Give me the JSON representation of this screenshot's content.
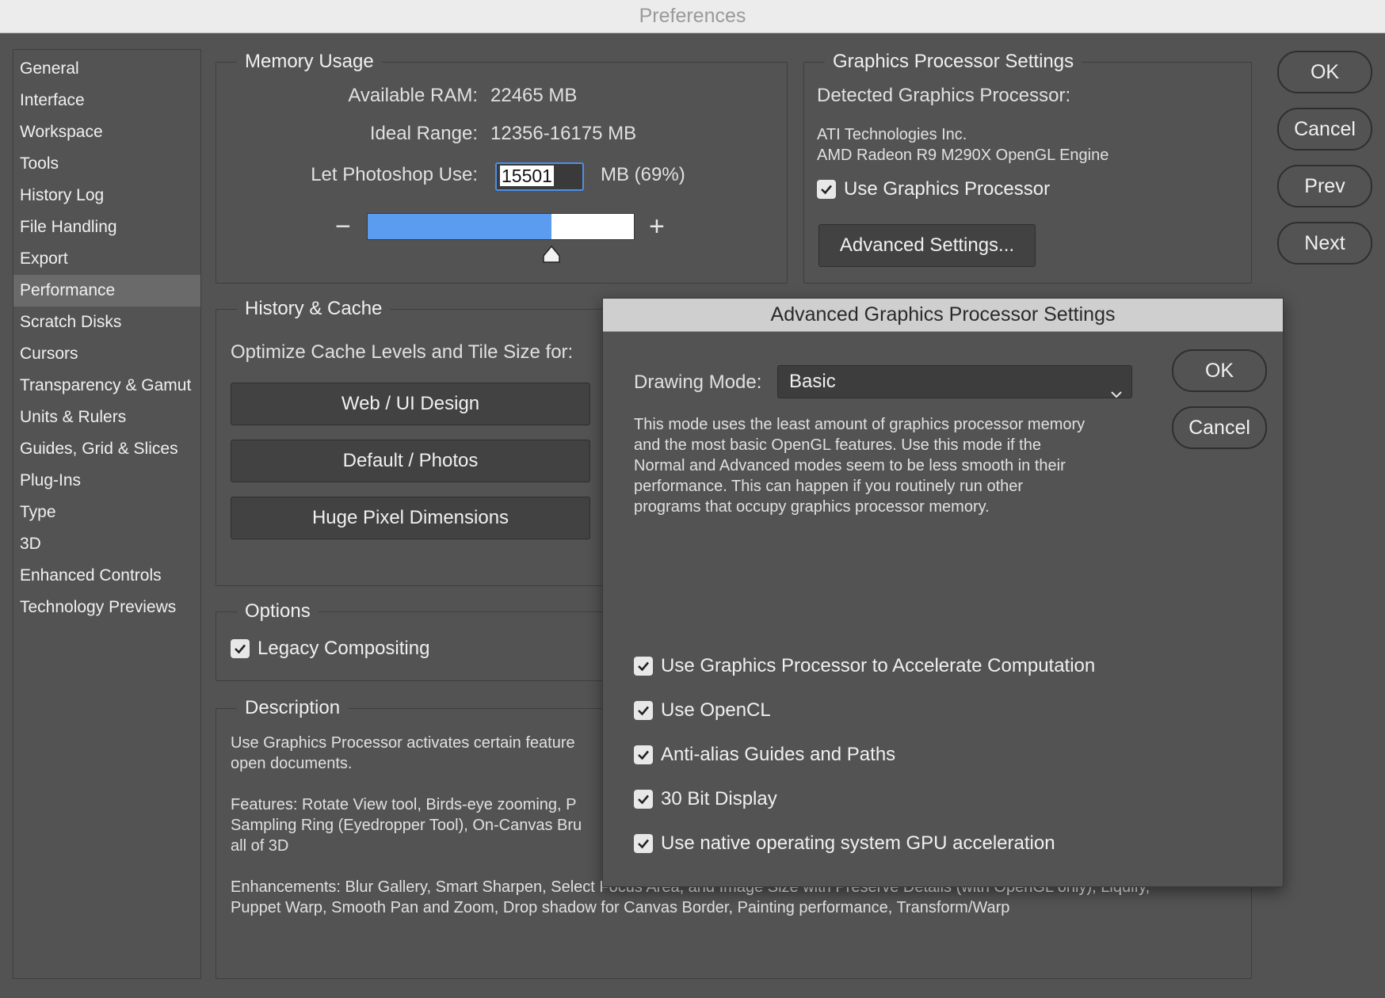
{
  "window": {
    "title": "Preferences"
  },
  "sidebar": {
    "items": [
      {
        "label": "General"
      },
      {
        "label": "Interface"
      },
      {
        "label": "Workspace"
      },
      {
        "label": "Tools"
      },
      {
        "label": "History Log"
      },
      {
        "label": "File Handling"
      },
      {
        "label": "Export"
      },
      {
        "label": "Performance"
      },
      {
        "label": "Scratch Disks"
      },
      {
        "label": "Cursors"
      },
      {
        "label": "Transparency & Gamut"
      },
      {
        "label": "Units & Rulers"
      },
      {
        "label": "Guides, Grid & Slices"
      },
      {
        "label": "Plug-Ins"
      },
      {
        "label": "Type"
      },
      {
        "label": "3D"
      },
      {
        "label": "Enhanced Controls"
      },
      {
        "label": "Technology Previews"
      }
    ],
    "selected": "Performance"
  },
  "memory": {
    "title": "Memory Usage",
    "available_label": "Available RAM:",
    "available_value": "22465 MB",
    "ideal_label": "Ideal Range:",
    "ideal_value": "12356-16175 MB",
    "use_label": "Let Photoshop Use:",
    "use_value": "15501",
    "use_unit": "MB (69%)",
    "slider_fraction": 0.69,
    "minus": "−",
    "plus": "+"
  },
  "gpu": {
    "title": "Graphics Processor Settings",
    "detected_label": "Detected Graphics Processor:",
    "vendor": "ATI Technologies Inc.",
    "model": "AMD Radeon R9 M290X OpenGL Engine",
    "use_gpu_label": "Use Graphics Processor",
    "advanced_button": "Advanced Settings..."
  },
  "actions": {
    "ok": "OK",
    "cancel": "Cancel",
    "prev": "Prev",
    "next": "Next"
  },
  "history_cache": {
    "title": "History & Cache",
    "optimize_label": "Optimize Cache Levels and Tile Size for:",
    "btn_web": "Web / UI Design",
    "btn_default": "Default / Photos",
    "btn_huge": "Huge Pixel Dimensions"
  },
  "options": {
    "title": "Options",
    "legacy_label": "Legacy Compositing"
  },
  "description": {
    "title": "Description",
    "line1": "Use Graphics Processor activates certain feature",
    "line2": "open documents.",
    "line3": "Features: Rotate View tool, Birds-eye zooming, P",
    "line4": "Sampling Ring (Eyedropper Tool), On-Canvas Bru",
    "line5": "all of 3D",
    "line6": "Enhancements: Blur Gallery, Smart Sharpen, Select Focus Area, and Image Size with Preserve Details (with OpenGL only), Liquify,",
    "line7": "Puppet Warp, Smooth Pan and Zoom, Drop shadow for Canvas Border, Painting performance, Transform/Warp"
  },
  "modal": {
    "title": "Advanced Graphics Processor Settings",
    "drawing_mode_label": "Drawing Mode:",
    "drawing_mode_value": "Basic",
    "desc1": "This mode uses the least amount of graphics processor memory",
    "desc2": "and the most basic OpenGL features.  Use this mode if the",
    "desc3": "Normal and Advanced modes seem to be less smooth in their",
    "desc4": "performance.  This can happen if you routinely run other",
    "desc5": "programs that occupy graphics processor memory.",
    "ok": "OK",
    "cancel": "Cancel",
    "checkboxes": [
      {
        "label": "Use Graphics Processor to Accelerate Computation",
        "checked": true
      },
      {
        "label": "Use OpenCL",
        "checked": true
      },
      {
        "label": "Anti-alias Guides and Paths",
        "checked": true
      },
      {
        "label": "30 Bit Display",
        "checked": true
      },
      {
        "label": "Use native operating system GPU acceleration",
        "checked": true
      }
    ]
  },
  "colors": {
    "accent": "#5b9cf0",
    "panel": "#535353",
    "border": "#3e3e3e"
  }
}
